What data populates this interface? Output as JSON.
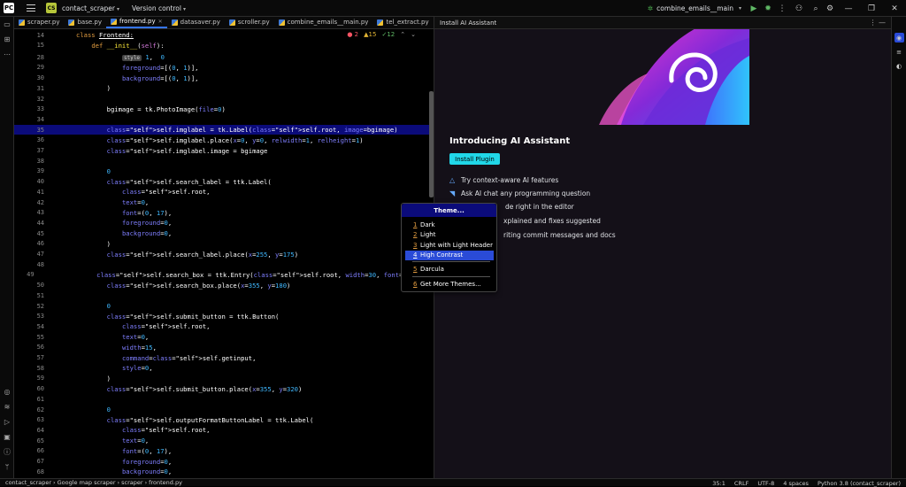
{
  "titlebar": {
    "app_icon": "PC",
    "project_badge": "CS",
    "project": "contact_scraper",
    "vcs": "Version control",
    "run_config": "combine_emails__main"
  },
  "tabs": [
    {
      "label": "scraper.py"
    },
    {
      "label": "base.py"
    },
    {
      "label": "frontend.py"
    },
    {
      "label": "datasaver.py"
    },
    {
      "label": "scroller.py"
    },
    {
      "label": "combine_emails__main.py"
    },
    {
      "label": "tel_extract.py"
    }
  ],
  "editor": {
    "breadcrumb_lines": [
      {
        "num": "14",
        "code": "class Frontend:"
      },
      {
        "num": "15",
        "code": "    def __init__(self):"
      }
    ],
    "analysis": {
      "errors": "2",
      "warnings": "15",
      "ok": "12"
    },
    "inline_hint": "style",
    "lines": [
      {
        "num": "28",
        "code": "            \"my.TButton\",  # making style for our buttons"
      },
      {
        "num": "29",
        "code": "            foreground=[(\"active\", \"green\")],"
      },
      {
        "num": "30",
        "code": "            background=[(\"active\", \"white\")],"
      },
      {
        "num": "31",
        "code": "        )"
      },
      {
        "num": "32",
        "code": ""
      },
      {
        "num": "33",
        "code": "        bgimage = tk.PhotoImage(file=\"Google map scraper\\images\\Home.png\")"
      },
      {
        "num": "34",
        "code": ""
      },
      {
        "num": "35",
        "code": "        self.imglabel = tk.Label(self.root, image=bgimage)"
      },
      {
        "num": "36",
        "code": "        self.imglabel.place(x=0, y=0, relwidth=1, relheight=1)"
      },
      {
        "num": "37",
        "code": "        self.imglabel.image = bgimage"
      },
      {
        "num": "38",
        "code": ""
      },
      {
        "num": "39",
        "code": "        \"\"\"For search entry\"\"\""
      },
      {
        "num": "40",
        "code": "        self.search_label = ttk.Label("
      },
      {
        "num": "41",
        "code": "            self.root,"
      },
      {
        "num": "42",
        "code": "            text=\"Search:\","
      },
      {
        "num": "43",
        "code": "            font=(\"Franklin Gothic Medium\", 17),"
      },
      {
        "num": "44",
        "code": "            foreground=\"green\","
      },
      {
        "num": "45",
        "code": "            background=\"white\","
      },
      {
        "num": "46",
        "code": "        )"
      },
      {
        "num": "47",
        "code": "        self.search_label.place(x=255, y=175)"
      },
      {
        "num": "48",
        "code": ""
      },
      {
        "num": "49",
        "code": "        self.search_box = ttk.Entry(self.root, width=30, font=(\"Arial\", 15))"
      },
      {
        "num": "50",
        "code": "        self.search_box.place(x=355, y=180)"
      },
      {
        "num": "51",
        "code": ""
      },
      {
        "num": "52",
        "code": "        \"\"\"For submit button\"\"\""
      },
      {
        "num": "53",
        "code": "        self.submit_button = ttk.Button("
      },
      {
        "num": "54",
        "code": "            self.root,"
      },
      {
        "num": "55",
        "code": "            text=\"Submit\","
      },
      {
        "num": "56",
        "code": "            width=15,"
      },
      {
        "num": "57",
        "code": "            command=self.getinput,"
      },
      {
        "num": "58",
        "code": "            style=\"my.TButton\","
      },
      {
        "num": "59",
        "code": "        )"
      },
      {
        "num": "60",
        "code": "        self.submit_button.place(x=355, y=320)"
      },
      {
        "num": "61",
        "code": ""
      },
      {
        "num": "62",
        "code": "        \"\"\"For output format entry\"\"\""
      },
      {
        "num": "63",
        "code": "        self.outputFormatButtonLabel = ttk.Label("
      },
      {
        "num": "64",
        "code": "            self.root,"
      },
      {
        "num": "65",
        "code": "            text=\"Format:\","
      },
      {
        "num": "66",
        "code": "            font=(\"Franklin Gothic Medium\", 17),"
      },
      {
        "num": "67",
        "code": "            foreground=\"green\","
      },
      {
        "num": "68",
        "code": "            background=\"white\","
      }
    ]
  },
  "ai_panel": {
    "header": "Install AI Assistant",
    "title": "Introducing AI Assistant",
    "install_button": "Install Plugin",
    "features": [
      "Try context-aware AI features",
      "Ask AI chat any programming question",
      "de right in the editor",
      "xplained and fixes suggested",
      "riting commit messages and docs"
    ]
  },
  "theme_popup": {
    "title": "Theme...",
    "items": [
      {
        "n": "1",
        "label": "Dark"
      },
      {
        "n": "2",
        "label": "Light"
      },
      {
        "n": "3",
        "label": "Light with Light Header"
      },
      {
        "n": "4",
        "label": "High Contrast"
      },
      {
        "n": "5",
        "label": "Darcula"
      },
      {
        "n": "6",
        "label": "Get More Themes..."
      }
    ]
  },
  "statusbar": {
    "breadcrumbs": [
      "contact_scraper",
      "Google map scraper",
      "scraper",
      "frontend.py"
    ],
    "position": "35:1",
    "line_sep": "CRLF",
    "encoding": "UTF-8",
    "indent": "4 spaces",
    "interpreter": "Python 3.8 (contact_scraper)"
  },
  "colors": {
    "accent": "#3574f0",
    "highlight_line": "#0b0b7a",
    "install_button": "#21d7e8",
    "popup_selected": "#2a4bd7"
  }
}
